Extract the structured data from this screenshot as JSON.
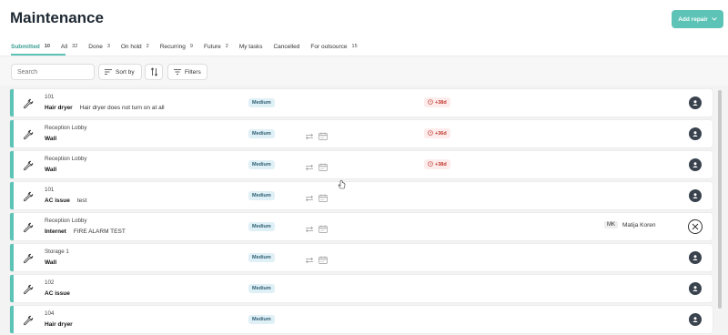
{
  "header": {
    "title": "Maintenance",
    "add_label": "Add repair"
  },
  "tabs": [
    {
      "label": "Submitted",
      "count": "10",
      "active": true
    },
    {
      "label": "All",
      "count": "32"
    },
    {
      "label": "Done",
      "count": "3"
    },
    {
      "label": "On hold",
      "count": "2"
    },
    {
      "label": "Recurring",
      "count": "9"
    },
    {
      "label": "Future",
      "count": "2"
    },
    {
      "label": "My tasks",
      "count": ""
    },
    {
      "label": "Cancelled",
      "count": ""
    },
    {
      "label": "For outsource",
      "count": "15"
    }
  ],
  "toolbar": {
    "search_placeholder": "Search",
    "sort_label": "Sort by",
    "filters_label": "Filters"
  },
  "rows": [
    {
      "location": "101",
      "item": "Hair dryer",
      "description": "Hair dryer does not turn on at all",
      "priority": "Medium",
      "icons": false,
      "overdue": "+38d",
      "assignee": null
    },
    {
      "location": "Reception Lobby",
      "item": "Wall",
      "description": "",
      "priority": "Medium",
      "icons": true,
      "overdue": "+36d",
      "assignee": null
    },
    {
      "location": "Reception Lobby",
      "item": "Wall",
      "description": "",
      "priority": "Medium",
      "icons": true,
      "overdue": "+38d",
      "assignee": null
    },
    {
      "location": "101",
      "item": "AC issue",
      "description": "test",
      "priority": "Medium",
      "icons": true,
      "overdue": "",
      "assignee": null
    },
    {
      "location": "Reception Lobby",
      "item": "Internet",
      "description": "FIRE ALARM TEST",
      "priority": "Medium",
      "icons": true,
      "overdue": "",
      "assignee": {
        "initials": "MK",
        "name": "Matija Koren"
      }
    },
    {
      "location": "Storage 1",
      "item": "Wall",
      "description": "",
      "priority": "Medium",
      "icons": true,
      "overdue": "",
      "assignee": null
    },
    {
      "location": "102",
      "item": "AC issue",
      "description": "",
      "priority": "Medium",
      "icons": false,
      "overdue": "",
      "assignee": null
    },
    {
      "location": "104",
      "item": "Hair dryer",
      "description": "",
      "priority": "Medium",
      "icons": false,
      "overdue": "",
      "assignee": null
    }
  ],
  "colors": {
    "accent": "#5cc3b6",
    "overdue": "#c0392b",
    "priority_bg": "#e0f0f7"
  }
}
